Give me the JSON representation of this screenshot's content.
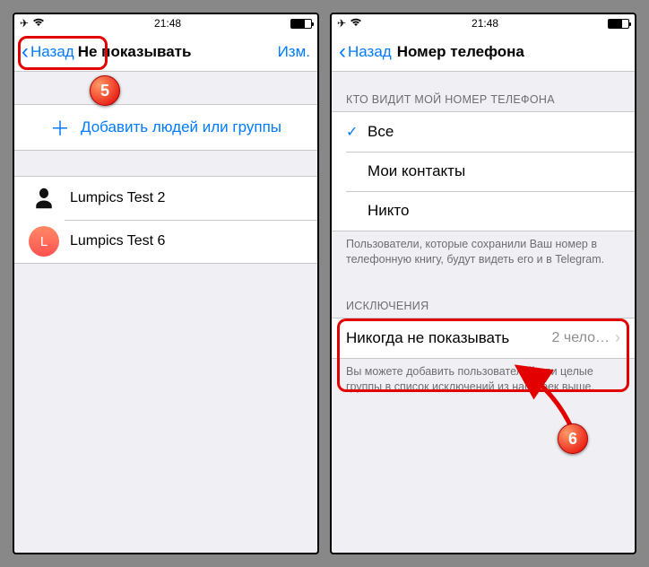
{
  "status": {
    "time": "21:48"
  },
  "left": {
    "nav_back": "Назад",
    "nav_title": "Не показывать",
    "nav_edit": "Изм.",
    "add_label": "Добавить людей или группы",
    "contacts": [
      {
        "name": "Lumpics Test 2",
        "initial": "",
        "color": ""
      },
      {
        "name": "Lumpics Test 6",
        "initial": "L",
        "color": "linear-gradient(#ff8a65,#ff5252)"
      }
    ]
  },
  "right": {
    "nav_back": "Назад",
    "nav_title": "Номер телефона",
    "section1_header": "КТО ВИДИТ МОЙ НОМЕР ТЕЛЕФОНА",
    "options": [
      {
        "label": "Все",
        "checked": true
      },
      {
        "label": "Мои контакты",
        "checked": false
      },
      {
        "label": "Никто",
        "checked": false
      }
    ],
    "section1_footer": "Пользователи, которые сохранили Ваш номер в телефонную книгу, будут видеть его и в Telegram.",
    "section2_header": "ИСКЛЮЧЕНИЯ",
    "exception_label": "Никогда не показывать",
    "exception_value": "2 чело…",
    "section2_footer": "Вы можете добавить пользователей или целые группы в список исключений из настроек выше."
  },
  "steps": {
    "five": "5",
    "six": "6"
  }
}
